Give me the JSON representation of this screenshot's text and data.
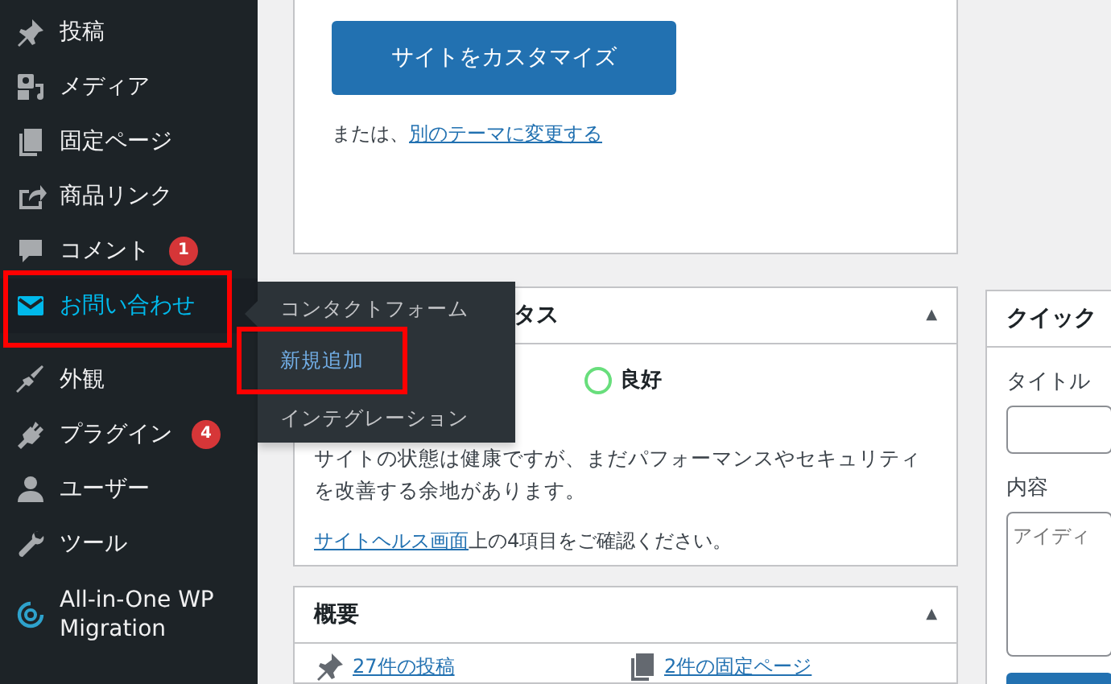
{
  "sidebar": {
    "items": [
      {
        "label": "投稿",
        "selected": false
      },
      {
        "label": "メディア",
        "selected": false
      },
      {
        "label": "固定ページ",
        "selected": false
      },
      {
        "label": "商品リンク",
        "selected": false
      },
      {
        "label": "コメント",
        "badge": "1",
        "selected": false
      },
      {
        "label": "お問い合わせ",
        "selected": true
      },
      {
        "label": "外観",
        "selected": false
      },
      {
        "label": "プラグイン",
        "badge": "4",
        "selected": false
      },
      {
        "label": "ユーザー",
        "selected": false
      },
      {
        "label": "ツール",
        "selected": false
      },
      {
        "label": "All-in-One WP Migration",
        "selected": false
      }
    ]
  },
  "flyout": {
    "items": [
      {
        "label": "コンタクトフォーム",
        "selected": false
      },
      {
        "label": "新規追加",
        "selected": true
      },
      {
        "label": "インテグレーション",
        "selected": false
      }
    ]
  },
  "customize_card": {
    "button": "サイトをカスタマイズ",
    "text": "または、",
    "link": "別のテーマに変更する"
  },
  "site_health": {
    "title": "タス",
    "toggle": "▲",
    "status": "良好",
    "message": "サイトの状態は健康ですが、まだパフォーマンスやセキュリティを改善する余地があります。",
    "link": "サイトヘルス画面",
    "link_suffix": "上の4項目をご確認ください。"
  },
  "overview": {
    "title": "概要",
    "toggle": "▲",
    "items": [
      {
        "label": "27件の投稿"
      },
      {
        "label": "2件の固定ページ"
      }
    ]
  },
  "quick_draft": {
    "title": "クイック",
    "fields": [
      {
        "label": "タイトル",
        "kind": "input"
      },
      {
        "label": "内容",
        "kind": "textarea",
        "placeholder": "アイディ"
      }
    ]
  }
}
